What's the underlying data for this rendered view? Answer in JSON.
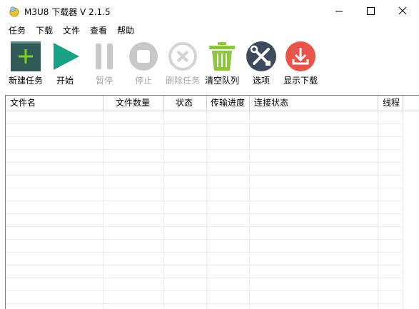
{
  "window": {
    "title": "M3U8 下载器 V 2.1.5",
    "icon": "app-logo-icon"
  },
  "menu": [
    {
      "label": "任务"
    },
    {
      "label": "下载"
    },
    {
      "label": "文件"
    },
    {
      "label": "查看"
    },
    {
      "label": "帮助"
    }
  ],
  "toolbar": {
    "new_task": {
      "label": "新建任务",
      "icon": "add-task-icon",
      "enabled": true
    },
    "start": {
      "label": "开始",
      "icon": "play-icon",
      "enabled": true
    },
    "pause": {
      "label": "暂停",
      "icon": "pause-icon",
      "enabled": false
    },
    "stop": {
      "label": "停止",
      "icon": "stop-icon",
      "enabled": false
    },
    "delete_task": {
      "label": "删除任务",
      "icon": "delete-icon",
      "enabled": false
    },
    "clear_queue": {
      "label": "清空队列",
      "icon": "trash-icon",
      "enabled": true
    },
    "options": {
      "label": "选项",
      "icon": "tools-icon",
      "enabled": true
    },
    "show_downloads": {
      "label": "显示下载",
      "icon": "download-icon",
      "enabled": true
    }
  },
  "table": {
    "columns": [
      "文件名",
      "文件数量",
      "状态",
      "传输进度",
      "连接状态",
      "线程"
    ],
    "rows": []
  },
  "colors": {
    "new_task_bg": "#2f5a55",
    "new_task_plus": "#7ed321",
    "start_green": "#1aa085",
    "disabled_gray": "#c8c8c8",
    "trash_green": "#8dc63f",
    "tools_bg": "#3d4a5c",
    "download_red": "#e8534a"
  }
}
